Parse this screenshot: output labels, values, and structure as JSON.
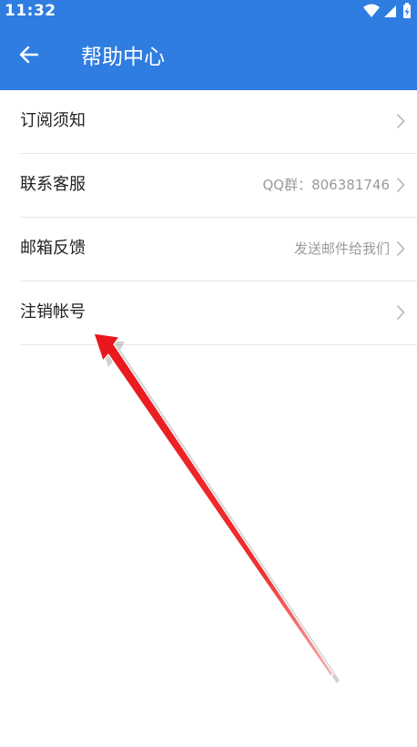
{
  "status_bar": {
    "time": "11:32",
    "icons": [
      "wifi-icon",
      "signal-icon",
      "battery-charging-icon"
    ]
  },
  "toolbar": {
    "back_icon": "arrow-left-icon",
    "title": "帮助中心"
  },
  "menu": {
    "items": [
      {
        "label": "订阅须知",
        "value": ""
      },
      {
        "label": "联系客服",
        "value": "QQ群：806381746"
      },
      {
        "label": "邮箱反馈",
        "value": "发送邮件给我们"
      },
      {
        "label": "注销帐号",
        "value": ""
      }
    ]
  },
  "colors": {
    "primary": "#2f7de1",
    "divider": "#e6e6e6",
    "annotation_arrow": "#e8161b"
  }
}
